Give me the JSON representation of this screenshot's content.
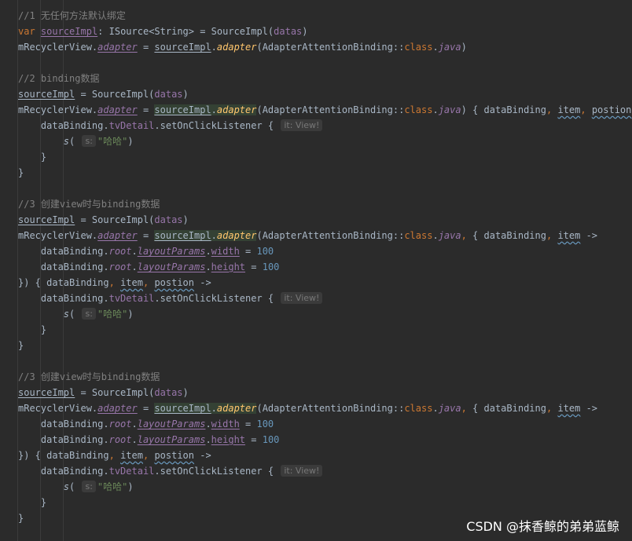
{
  "watermark": "CSDN @抹香鲸的弟弟蓝鲸",
  "code": {
    "c1": "//1 无任何方法默认绑定",
    "c2": "//2 binding数据",
    "c3": "//3 创建view时与binding数据",
    "c4": "//3 创建view时与binding数据",
    "hint_it": "it: View!",
    "hint_s": "s:",
    "str_haha": "\"哈哈\"",
    "num_100": "100"
  }
}
